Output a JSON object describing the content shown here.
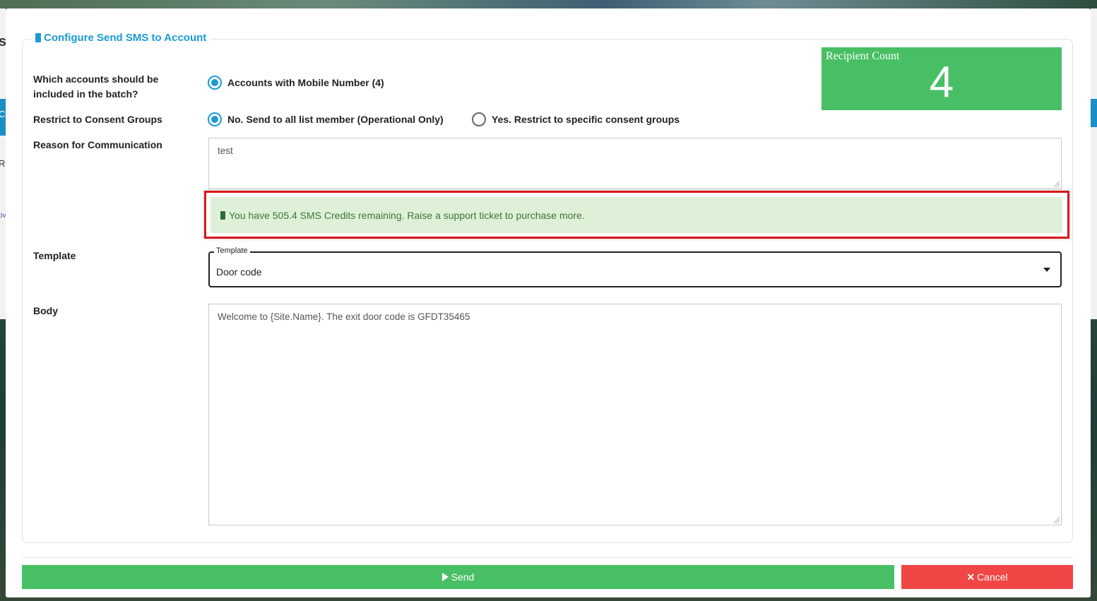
{
  "background": {
    "left_letters": [
      "s",
      "C",
      "R",
      "ov"
    ]
  },
  "dialog": {
    "title": "Configure Send SMS to Account",
    "title_icon": "mobile-phone-icon",
    "accent_color": "#1a9ad6"
  },
  "recipient": {
    "label": "Recipient Count",
    "count": "4",
    "color": "#48bf65"
  },
  "accounts": {
    "label": "Which accounts should be included in the batch?",
    "option": "Accounts with Mobile Number (4)",
    "selected": true
  },
  "consent": {
    "label": "Restrict to Consent Groups",
    "options": [
      {
        "label": "No. Send to all list member (Operational Only)",
        "selected": true
      },
      {
        "label": "Yes. Restrict to specific consent groups",
        "selected": false
      }
    ]
  },
  "reason": {
    "label": "Reason for Communication",
    "value": "test"
  },
  "credits": {
    "icon": "mobile-phone-icon",
    "message": "You have 505.4 SMS Credits remaining. Raise a support ticket to purchase more."
  },
  "template": {
    "label": "Template",
    "field_legend": "Template",
    "value": "Door code"
  },
  "body": {
    "label": "Body",
    "value": "Welcome to {Site.Name}.  The exit door code is GFDT35465"
  },
  "actions": {
    "send_label": "Send",
    "cancel_label": "Cancel",
    "send_color": "#48bf65",
    "cancel_color": "#f04646"
  }
}
